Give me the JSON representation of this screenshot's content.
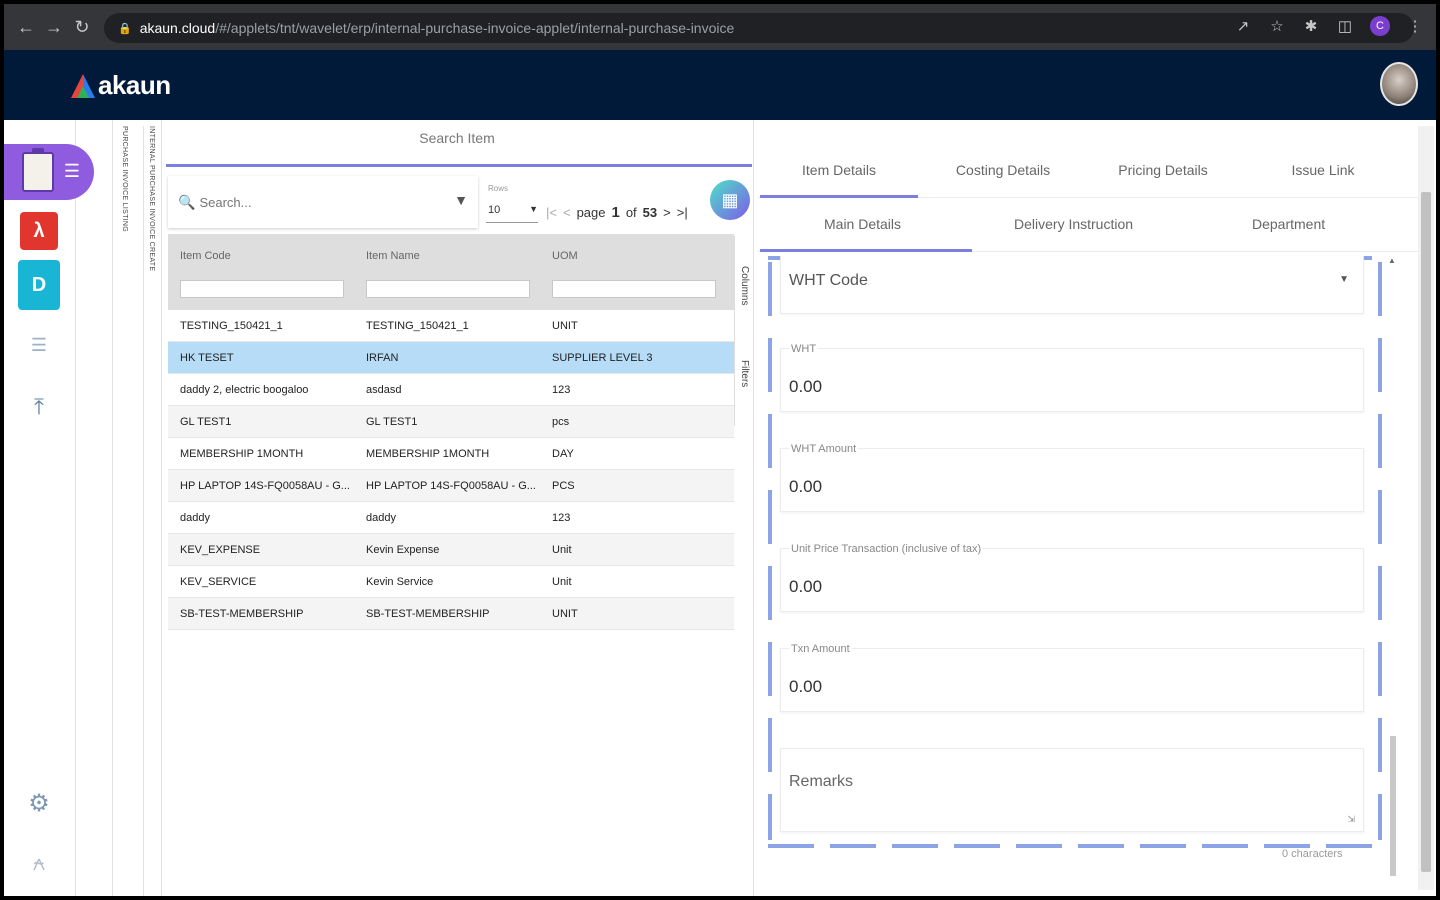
{
  "browser": {
    "url_host": "akaun.cloud",
    "url_path": "/#/applets/tnt/wavelet/erp/internal-purchase-invoice-applet/internal-purchase-invoice",
    "profile_letter": "C"
  },
  "app": {
    "brand": "akaun"
  },
  "vertical_tabs": [
    "PURCHASE INVOICE LISTING",
    "INTERNAL PURCHASE INVOICE CREATE"
  ],
  "search_panel": {
    "title": "Search Item",
    "search_placeholder": "Search...",
    "rows_label": "Rows",
    "rows_value": "10",
    "pager": {
      "page_label": "page",
      "page": "1",
      "of_label": "of",
      "total": "53"
    },
    "columns": [
      "Item Code",
      "Item Name",
      "UOM"
    ],
    "rows": [
      {
        "code": "TESTING_150421_1",
        "name": "TESTING_150421_1",
        "uom": "UNIT"
      },
      {
        "code": "HK TESET",
        "name": "IRFAN",
        "uom": "SUPPLIER LEVEL 3"
      },
      {
        "code": "daddy 2, electric boogaloo",
        "name": "asdasd",
        "uom": "123"
      },
      {
        "code": "GL TEST1",
        "name": "GL TEST1",
        "uom": "pcs"
      },
      {
        "code": "MEMBERSHIP 1MONTH",
        "name": "MEMBERSHIP 1MONTH",
        "uom": "DAY"
      },
      {
        "code": "HP LAPTOP 14S-FQ0058AU - G...",
        "name": "HP LAPTOP 14S-FQ0058AU - G...",
        "uom": "PCS"
      },
      {
        "code": "daddy",
        "name": "daddy",
        "uom": "123"
      },
      {
        "code": "KEV_EXPENSE",
        "name": "Kevin Expense",
        "uom": "Unit"
      },
      {
        "code": "KEV_SERVICE",
        "name": "Kevin Service",
        "uom": "Unit"
      },
      {
        "code": "SB-TEST-MEMBERSHIP",
        "name": "SB-TEST-MEMBERSHIP",
        "uom": "UNIT"
      }
    ],
    "side_toolbar": [
      "Columns",
      "Filters"
    ]
  },
  "detail": {
    "tabs": [
      "Item Details",
      "Costing Details",
      "Pricing Details",
      "Issue Link"
    ],
    "subtabs": [
      "Main Details",
      "Delivery Instruction",
      "Department"
    ],
    "fields": {
      "wht_code_label": "WHT Code",
      "wht_label": "WHT",
      "wht_value": "0.00",
      "wht_amount_label": "WHT Amount",
      "wht_amount_value": "0.00",
      "unit_price_label": "Unit Price Transaction (inclusive of tax)",
      "unit_price_value": "0.00",
      "txn_amount_label": "Txn Amount",
      "txn_amount_value": "0.00",
      "remarks_label": "Remarks",
      "char_count": "0 characters"
    }
  }
}
